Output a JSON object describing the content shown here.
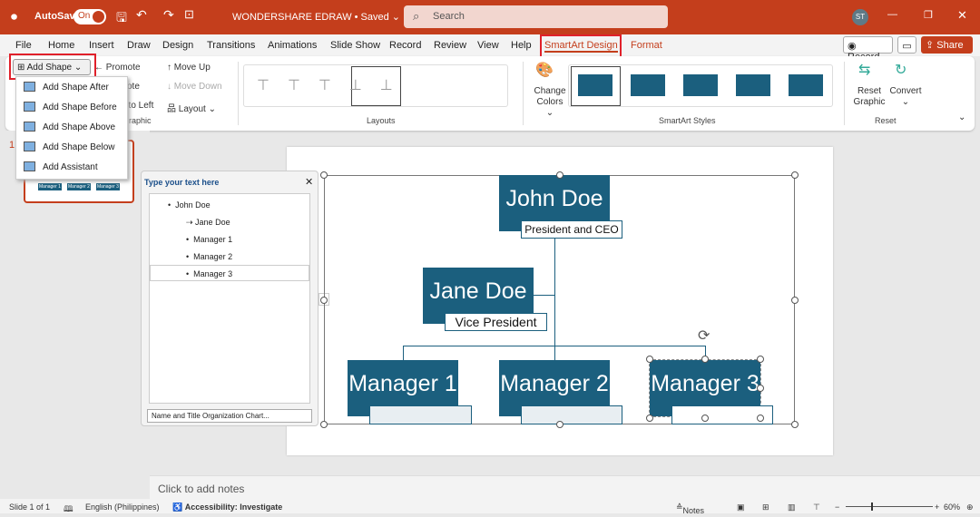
{
  "titlebar": {
    "autosave": "AutoSave",
    "toggle": "On",
    "doc_title": "WONDERSHARE EDRAW • Saved ⌄",
    "search_placeholder": "Search",
    "avatar": "ST"
  },
  "menu": {
    "tabs": [
      "File",
      "Home",
      "Insert",
      "Draw",
      "Design",
      "Transitions",
      "Animations",
      "Slide Show",
      "Record",
      "Review",
      "View",
      "Help",
      "SmartArt Design",
      "Format"
    ],
    "record": "Record",
    "share": "Share"
  },
  "ribbon": {
    "add_shape": "Add Shape",
    "promote": "Promote",
    "demote": "ote",
    "right_to_left": "t to Left",
    "move_up": "Move Up",
    "move_down": "Move Down",
    "layout": "Layout",
    "create_graphic": "raphic",
    "layouts": "Layouts",
    "change_colors": "Change Colors",
    "smartart_styles": "SmartArt Styles",
    "reset_graphic": "Reset Graphic",
    "convert": "Convert",
    "reset": "Reset"
  },
  "dropdown": [
    "Add Shape After",
    "Add Shape Before",
    "Add Shape Above",
    "Add Shape Below",
    "Add Assistant"
  ],
  "thumb": {
    "num": "1",
    "labels": [
      "Manager 1",
      "Manager 2",
      "Manager 3"
    ]
  },
  "textpane": {
    "title": "Type your text here",
    "items": [
      "John Doe",
      "Jane Doe",
      "Manager 1",
      "Manager 2",
      "Manager 3"
    ],
    "footer": "Name and Title Organization Chart..."
  },
  "chart": {
    "ceo": "John Doe",
    "ceo_title": "President and CEO",
    "vp": "Jane Doe",
    "vp_title": "Vice President",
    "m1": "Manager 1",
    "m2": "Manager 2",
    "m3": "Manager 3"
  },
  "notes": "Click to add notes",
  "status": {
    "slide": "Slide 1 of 1",
    "language": "English (Philippines)",
    "accessibility": "Accessibility: Investigate",
    "notes": "Notes",
    "zoom": "60%"
  },
  "colors": {
    "brand": "#c43e1c",
    "node": "#1b5f7e",
    "highlight": "#e0202a"
  }
}
